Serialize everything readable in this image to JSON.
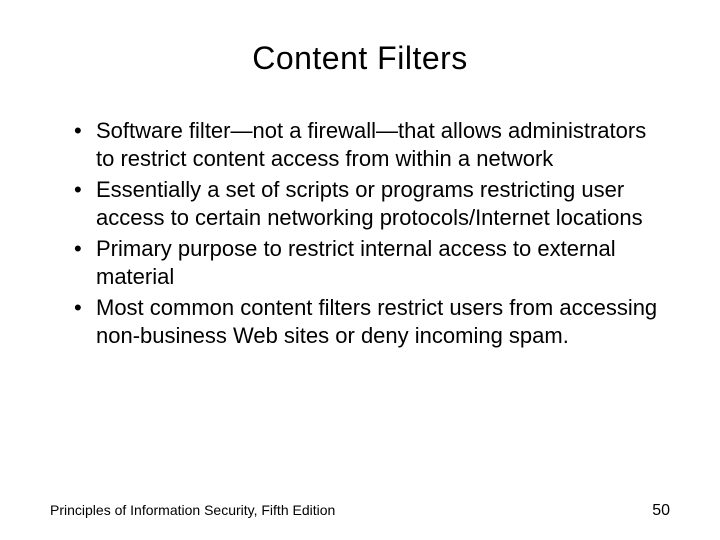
{
  "title": "Content Filters",
  "bullets": [
    "Software filter—not a firewall—that allows administrators to restrict content access from within a network",
    "Essentially a set of scripts or programs restricting user access to certain networking protocols/Internet locations",
    "Primary purpose to restrict internal access to external material",
    "Most common content filters restrict users from accessing non-business Web sites or deny incoming spam."
  ],
  "footer": {
    "source": "Principles of Information Security, Fifth Edition",
    "page": "50"
  }
}
